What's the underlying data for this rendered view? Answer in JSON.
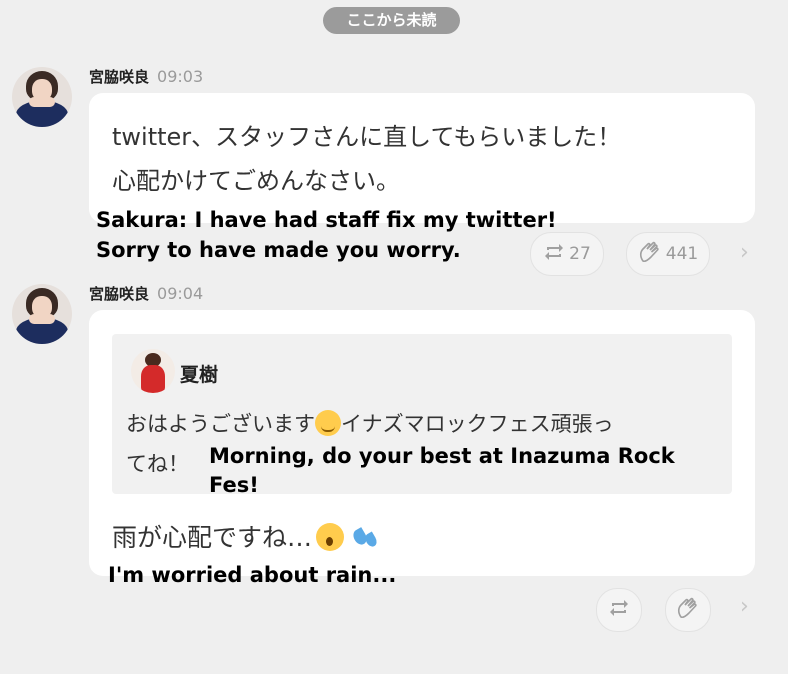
{
  "divider": {
    "label": "ここから未読"
  },
  "messages": [
    {
      "author": "宮脇咲良",
      "time": "09:03",
      "text_line1": "twitter、スタッフさんに直してもらいました！",
      "text_line2": "心配かけてごめんなさい。",
      "caption_line1": "Sakura: I have had staff fix my twitter!",
      "caption_line2": "Sorry to have made you worry.",
      "retweet_count": "27",
      "like_count": "441"
    },
    {
      "author": "宮脇咲良",
      "time": "09:04",
      "quote": {
        "author": "夏樹",
        "text_part1": "おはようございます",
        "text_part2": "イナズマロックフェス頑張っ",
        "text_line2": "てね！",
        "caption": "Morning, do your best at Inazuma Rock Fes!"
      },
      "text": "雨が心配ですね…",
      "caption": "I'm worried about rain..."
    }
  ],
  "icons": {
    "retweet": "retweet-icon",
    "like": "clap-hand-icon",
    "more": "chevron-right-icon"
  }
}
